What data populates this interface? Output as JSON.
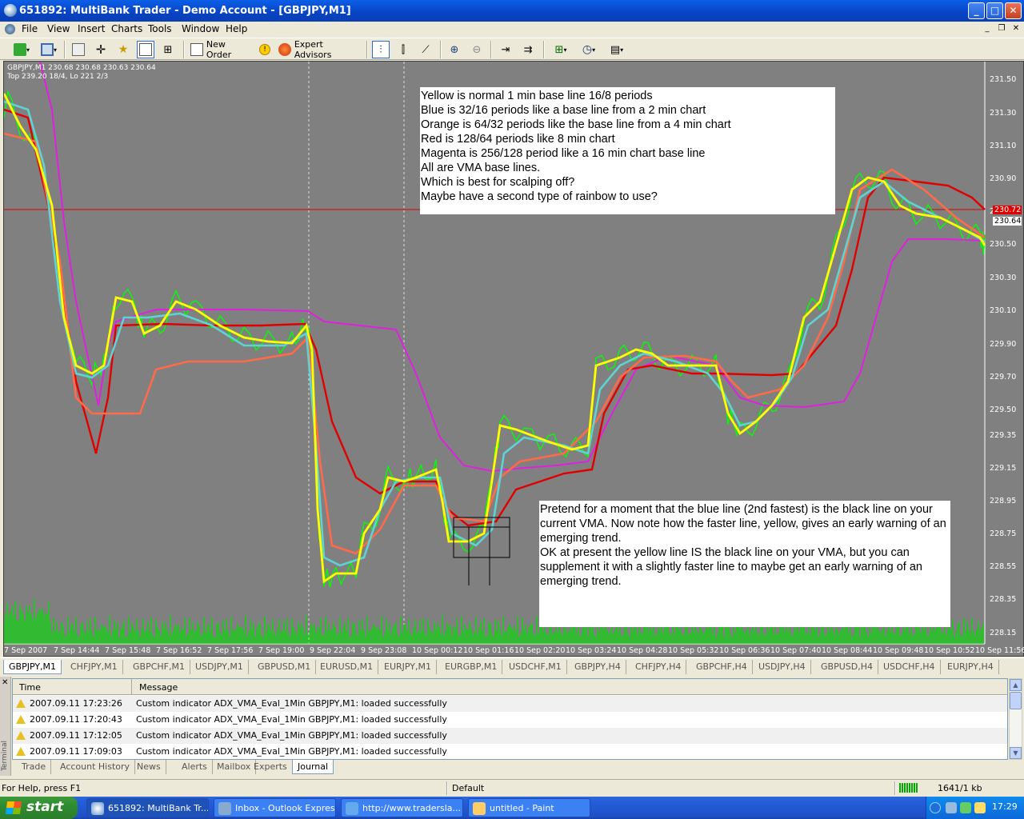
{
  "window": {
    "title": "651892: MultiBank Trader - Demo Account - [GBPJPY,M1]"
  },
  "menu": [
    "File",
    "View",
    "Insert",
    "Charts",
    "Tools",
    "Window",
    "Help"
  ],
  "toolbar": {
    "new_order": "New Order",
    "expert_advisors": "Expert Advisors"
  },
  "chart": {
    "header_line1": "GBPJPY,M1  230.68 230.68 230.63 230.64",
    "header_line2": "Top 239.20 18/4, Lo 221 2/3",
    "price_ticks": [
      "231.50",
      "231.30",
      "231.10",
      "230.90",
      "230.70",
      "230.50",
      "230.30",
      "230.10",
      "229.90",
      "229.70",
      "229.50",
      "229.35",
      "229.15",
      "228.95",
      "228.75",
      "228.55",
      "228.35",
      "228.15"
    ],
    "time_ticks": [
      "7 Sep 2007",
      "7 Sep 14:44",
      "7 Sep 15:48",
      "7 Sep 16:52",
      "7 Sep 17:56",
      "7 Sep 19:00",
      "9 Sep 22:04",
      "9 Sep 23:08",
      "10 Sep 00:12",
      "10 Sep 01:16",
      "10 Sep 02:20",
      "10 Sep 03:24",
      "10 Sep 04:28",
      "10 Sep 05:32",
      "10 Sep 06:36",
      "10 Sep 07:40",
      "10 Sep 08:44",
      "10 Sep 09:48",
      "10 Sep 10:52",
      "10 Sep 11:56"
    ],
    "price_badge_red": "230.72",
    "price_badge_current": "230.64",
    "note1": "Yellow is normal 1 min base line 16/8 periods\nBlue is 32/16 periods like a base line from a 2 min chart\nOrange is 64/32 periods like the base line from a 4 min chart\nRed is 128/64 periods like 8 min chart\nMagenta is 256/128 period like a 16 min chart base line\nAll are VMA base lines.\nWhich is best for scalping off?\nMaybe have a second type of rainbow to use?",
    "note2": "Pretend for a moment that the blue line (2nd fastest) is the black line on your current VMA. Now note how the faster line, yellow, gives an early warning of an emerging trend.\nOK at present the yellow line IS the black line on your VMA, but you can supplement it with a slightly faster line to maybe get an early warning of an emerging trend.",
    "colors": {
      "background": "#808080",
      "price": "#00ff00",
      "yellow": "#ffff00",
      "blue": "#5ed3d3",
      "orange": "#ff6a4a",
      "red": "#e00000",
      "magenta": "#e020e0"
    }
  },
  "chart_tabs": [
    "GBPJPY,M1",
    "CHFJPY,M1",
    "GBPCHF,M1",
    "USDJPY,M1",
    "GBPUSD,M1",
    "EURUSD,M1",
    "EURJPY,M1",
    "EURGBP,M1",
    "USDCHF,M1",
    "GBPJPY,H4",
    "CHFJPY,H4",
    "GBPCHF,H4",
    "USDJPY,H4",
    "GBPUSD,H4",
    "USDCHF,H4",
    "EURJPY,H4"
  ],
  "terminal": {
    "side_label": "Terminal",
    "columns": [
      "Time",
      "Message"
    ],
    "rows": [
      {
        "time": "2007.09.11 17:23:26",
        "message": "Custom indicator ADX_VMA_Eval_1Min GBPJPY,M1: loaded successfully"
      },
      {
        "time": "2007.09.11 17:20:43",
        "message": "Custom indicator ADX_VMA_Eval_1Min GBPJPY,M1: loaded successfully"
      },
      {
        "time": "2007.09.11 17:12:05",
        "message": "Custom indicator ADX_VMA_Eval_1Min GBPJPY,M1: loaded successfully"
      },
      {
        "time": "2007.09.11 17:09:03",
        "message": "Custom indicator ADX_VMA_Eval_1Min GBPJPY,M1: loaded successfully"
      }
    ],
    "tabs": [
      "Trade",
      "Account History",
      "News",
      "Alerts",
      "Mailbox",
      "Experts",
      "Journal"
    ]
  },
  "status": {
    "help": "For Help, press F1",
    "profile": "Default",
    "traffic": "1641/1 kb"
  },
  "taskbar": {
    "start": "start",
    "tasks": [
      "651892: MultiBank Tr...",
      "Inbox - Outlook Express",
      "http://www.tradersla...",
      "untitled - Paint"
    ],
    "clock": "17:29"
  }
}
